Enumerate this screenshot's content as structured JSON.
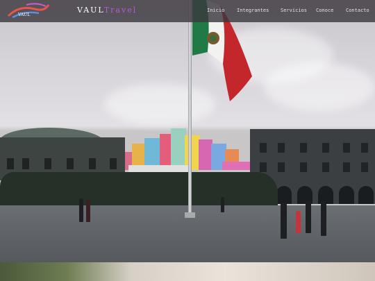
{
  "navbar": {
    "logo_text": "VAUL",
    "brand_part1": "VAUL",
    "brand_part2": "Travel",
    "links": [
      "Inicio",
      "Integrantes",
      "Servicios",
      "Conoce",
      "Contacto"
    ]
  },
  "hero": {
    "image": "photo-of-zocalo-mexico-city-plaza-with-flag",
    "flag_colors": [
      "#1f7a46",
      "#ffffff",
      "#c3262b"
    ]
  },
  "colors": {
    "nav_bg": "#3c383e",
    "brand_accent": "#b45bd6",
    "nav_text": "#e6e3e8"
  }
}
